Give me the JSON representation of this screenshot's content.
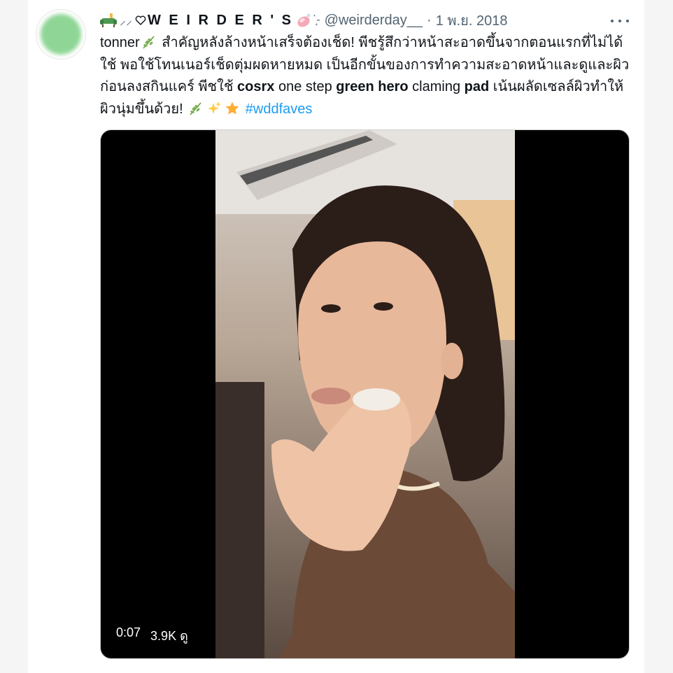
{
  "tweet": {
    "author": {
      "display_name": "W E I R D E R ' S",
      "display_prefix": "⸝⸝",
      "display_suffix": "ˋ͙-",
      "handle": "@weirderday__",
      "separator": "·",
      "date": "1 พ.ย. 2018"
    },
    "text": {
      "t1": "tonner",
      "t2": " สำคัญหลังล้างหน้าเสร็จต้องเช็ด! พีชรู้สึกว่าหน้าสะอาดขึ้นจากตอนแรกที่ไม่ได้ใช้ พอใช้โทนเนอร์เช็ดตุ่มผดหายหมด เป็นอีกขั้นของการทำความสะอาดหน้าและดูและผิวก่อนลงสกินแคร์ พีชใช้ ",
      "brand": "cosrx",
      "t3": " one step ",
      "product": "green hero",
      "t4": " claming ",
      "pad": "pad",
      "t5": " เน้นผลัดเซลล์ผิวทำให้ผิวนุ่มขึ้นด้วย! ",
      "hashtag": "#wddfaves"
    },
    "video": {
      "time": "0:07",
      "views": "3.9K ดู"
    },
    "icons": [
      "sofa-icon",
      "heart-icon",
      "soap-icon",
      "herb-icon",
      "sparkles-icon",
      "star-icon",
      "more-icon"
    ],
    "colors": {
      "link": "#1d9bf0",
      "secondary_text": "#536471",
      "avatar_green": "#8fd696"
    }
  }
}
